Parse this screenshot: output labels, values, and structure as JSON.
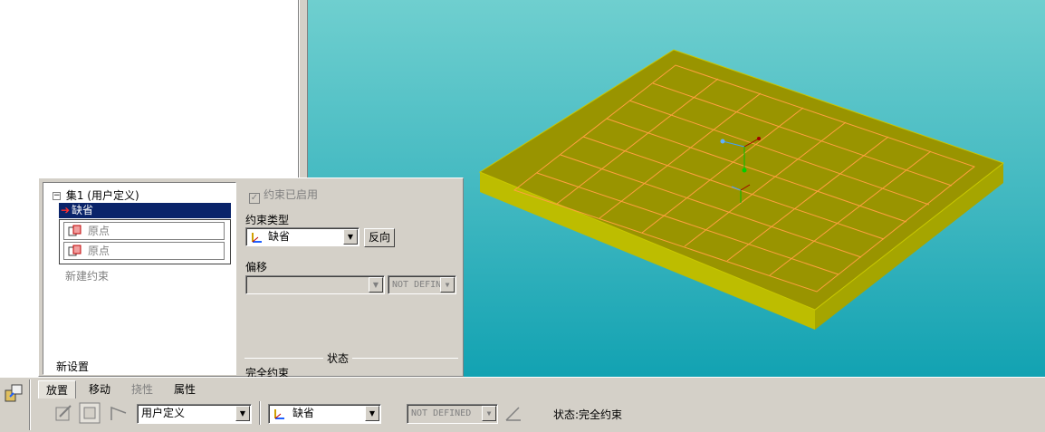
{
  "placement_panel": {
    "set_label": "集1 (用户定义)",
    "selected_constraint": "缺省",
    "references": [
      "原点",
      "原点"
    ],
    "new_constraint": "新建约束",
    "new_set": "新设置",
    "constraint_enabled": "约束已启用",
    "constraint_type_label": "约束类型",
    "constraint_type_value": "缺省",
    "flip_button": "反向",
    "offset_label": "偏移",
    "offset_value": "",
    "offset_unit": "NOT DEFINED",
    "status_title": "状态",
    "status_value": "完全约束"
  },
  "dashboard": {
    "tabs": [
      {
        "label": "放置",
        "state": "active"
      },
      {
        "label": "移动",
        "state": "normal"
      },
      {
        "label": "挠性",
        "state": "disabled"
      },
      {
        "label": "属性",
        "state": "normal"
      }
    ],
    "connection_type": "用户定义",
    "constraint_type": "缺省",
    "offset": "NOT DEFINED",
    "status": "状态:完全约束"
  },
  "colors": {
    "background_top": "#6fcfcf",
    "background_bottom": "#12a2b2",
    "plate_top": "#999400",
    "plate_side": "#c9c800",
    "grid_lines": "#ffa040",
    "selection": "#0a246a"
  },
  "icons": [
    "constraint-placement-icon",
    "default-constraint-icon",
    "datum-point-icon",
    "angle-icon"
  ]
}
